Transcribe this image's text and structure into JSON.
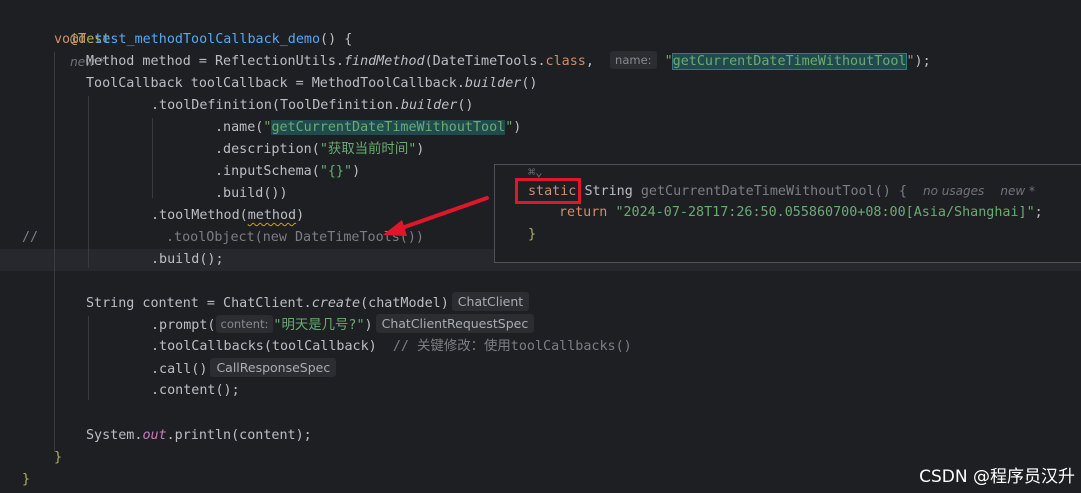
{
  "code": {
    "annotation": "@Test",
    "new_meta": "new *",
    "void_kw": "void",
    "method_name": "test_methodToolCallback_demo",
    "sig_tail": "() {",
    "l3_a": "Method method = ReflectionUtils.",
    "l3_find": "findMethod",
    "l3_b": "(DateTimeTools.",
    "l3_class": "class",
    "l3_c": ", ",
    "l3_hint": "name:",
    "l3_q1": "\"",
    "l3_str": "getCurrentDateTimeWithoutTool",
    "l3_q2": "\"",
    "l3_end": ");",
    "l4_a": "ToolCallback toolCallback = MethodToolCallback.",
    "l4_builder": "builder",
    "l4_end": "()",
    "l5_a": ".toolDefinition(ToolDefinition.",
    "l5_builder": "builder",
    "l5_end": "()",
    "l6_a": ".name(",
    "l6_q1": "\"",
    "l6_str": "getCurrentDateTimeWithoutTool",
    "l6_q2": "\"",
    "l6_end": ")",
    "l7_a": ".description(",
    "l7_str": "\"获取当前时间\"",
    "l7_end": ")",
    "l8_a": ".inputSchema(",
    "l8_str": "\"{}\"",
    "l8_end": ")",
    "l9": ".build())",
    "l10_a": ".toolMethod(",
    "l10_var": "method",
    "l10_end": ")",
    "l11_slashes": "//",
    "l11_text": ".toolObject(new DateTimeTools())",
    "l12_a": ".build",
    "l12_end": "();",
    "l14_a": "String content = ChatClient.",
    "l14_create": "create",
    "l14_b": "(chatModel)",
    "l14_type": "ChatClient",
    "l15_a": ".prompt(",
    "l15_hint": "content:",
    "l15_str": "\"明天是几号?\"",
    "l15_end": ")",
    "l15_type": "ChatClientRequestSpec",
    "l16_a": ".toolCallbacks(toolCallback)",
    "l16_comment": "// 关键修改：使用toolCallbacks()",
    "l17_a": ".call()",
    "l17_type": "CallResponseSpec",
    "l18_a": ".content();",
    "l20_a": "System.",
    "l20_out": "out",
    "l20_b": ".println(content);",
    "close_inner": "}",
    "close_outer": "}"
  },
  "popup": {
    "static_kw": "static",
    "type": "String",
    "name": "getCurrentDateTimeWithoutTool() {",
    "usages": "no usages",
    "new_meta": "new *",
    "return_kw": "return",
    "return_val": "\"2024-07-28T17:26:50.055860700+08:00[Asia/Shanghai]\"",
    "return_end": ";",
    "close": "}"
  },
  "watermark": "CSDN @程序员汉升"
}
